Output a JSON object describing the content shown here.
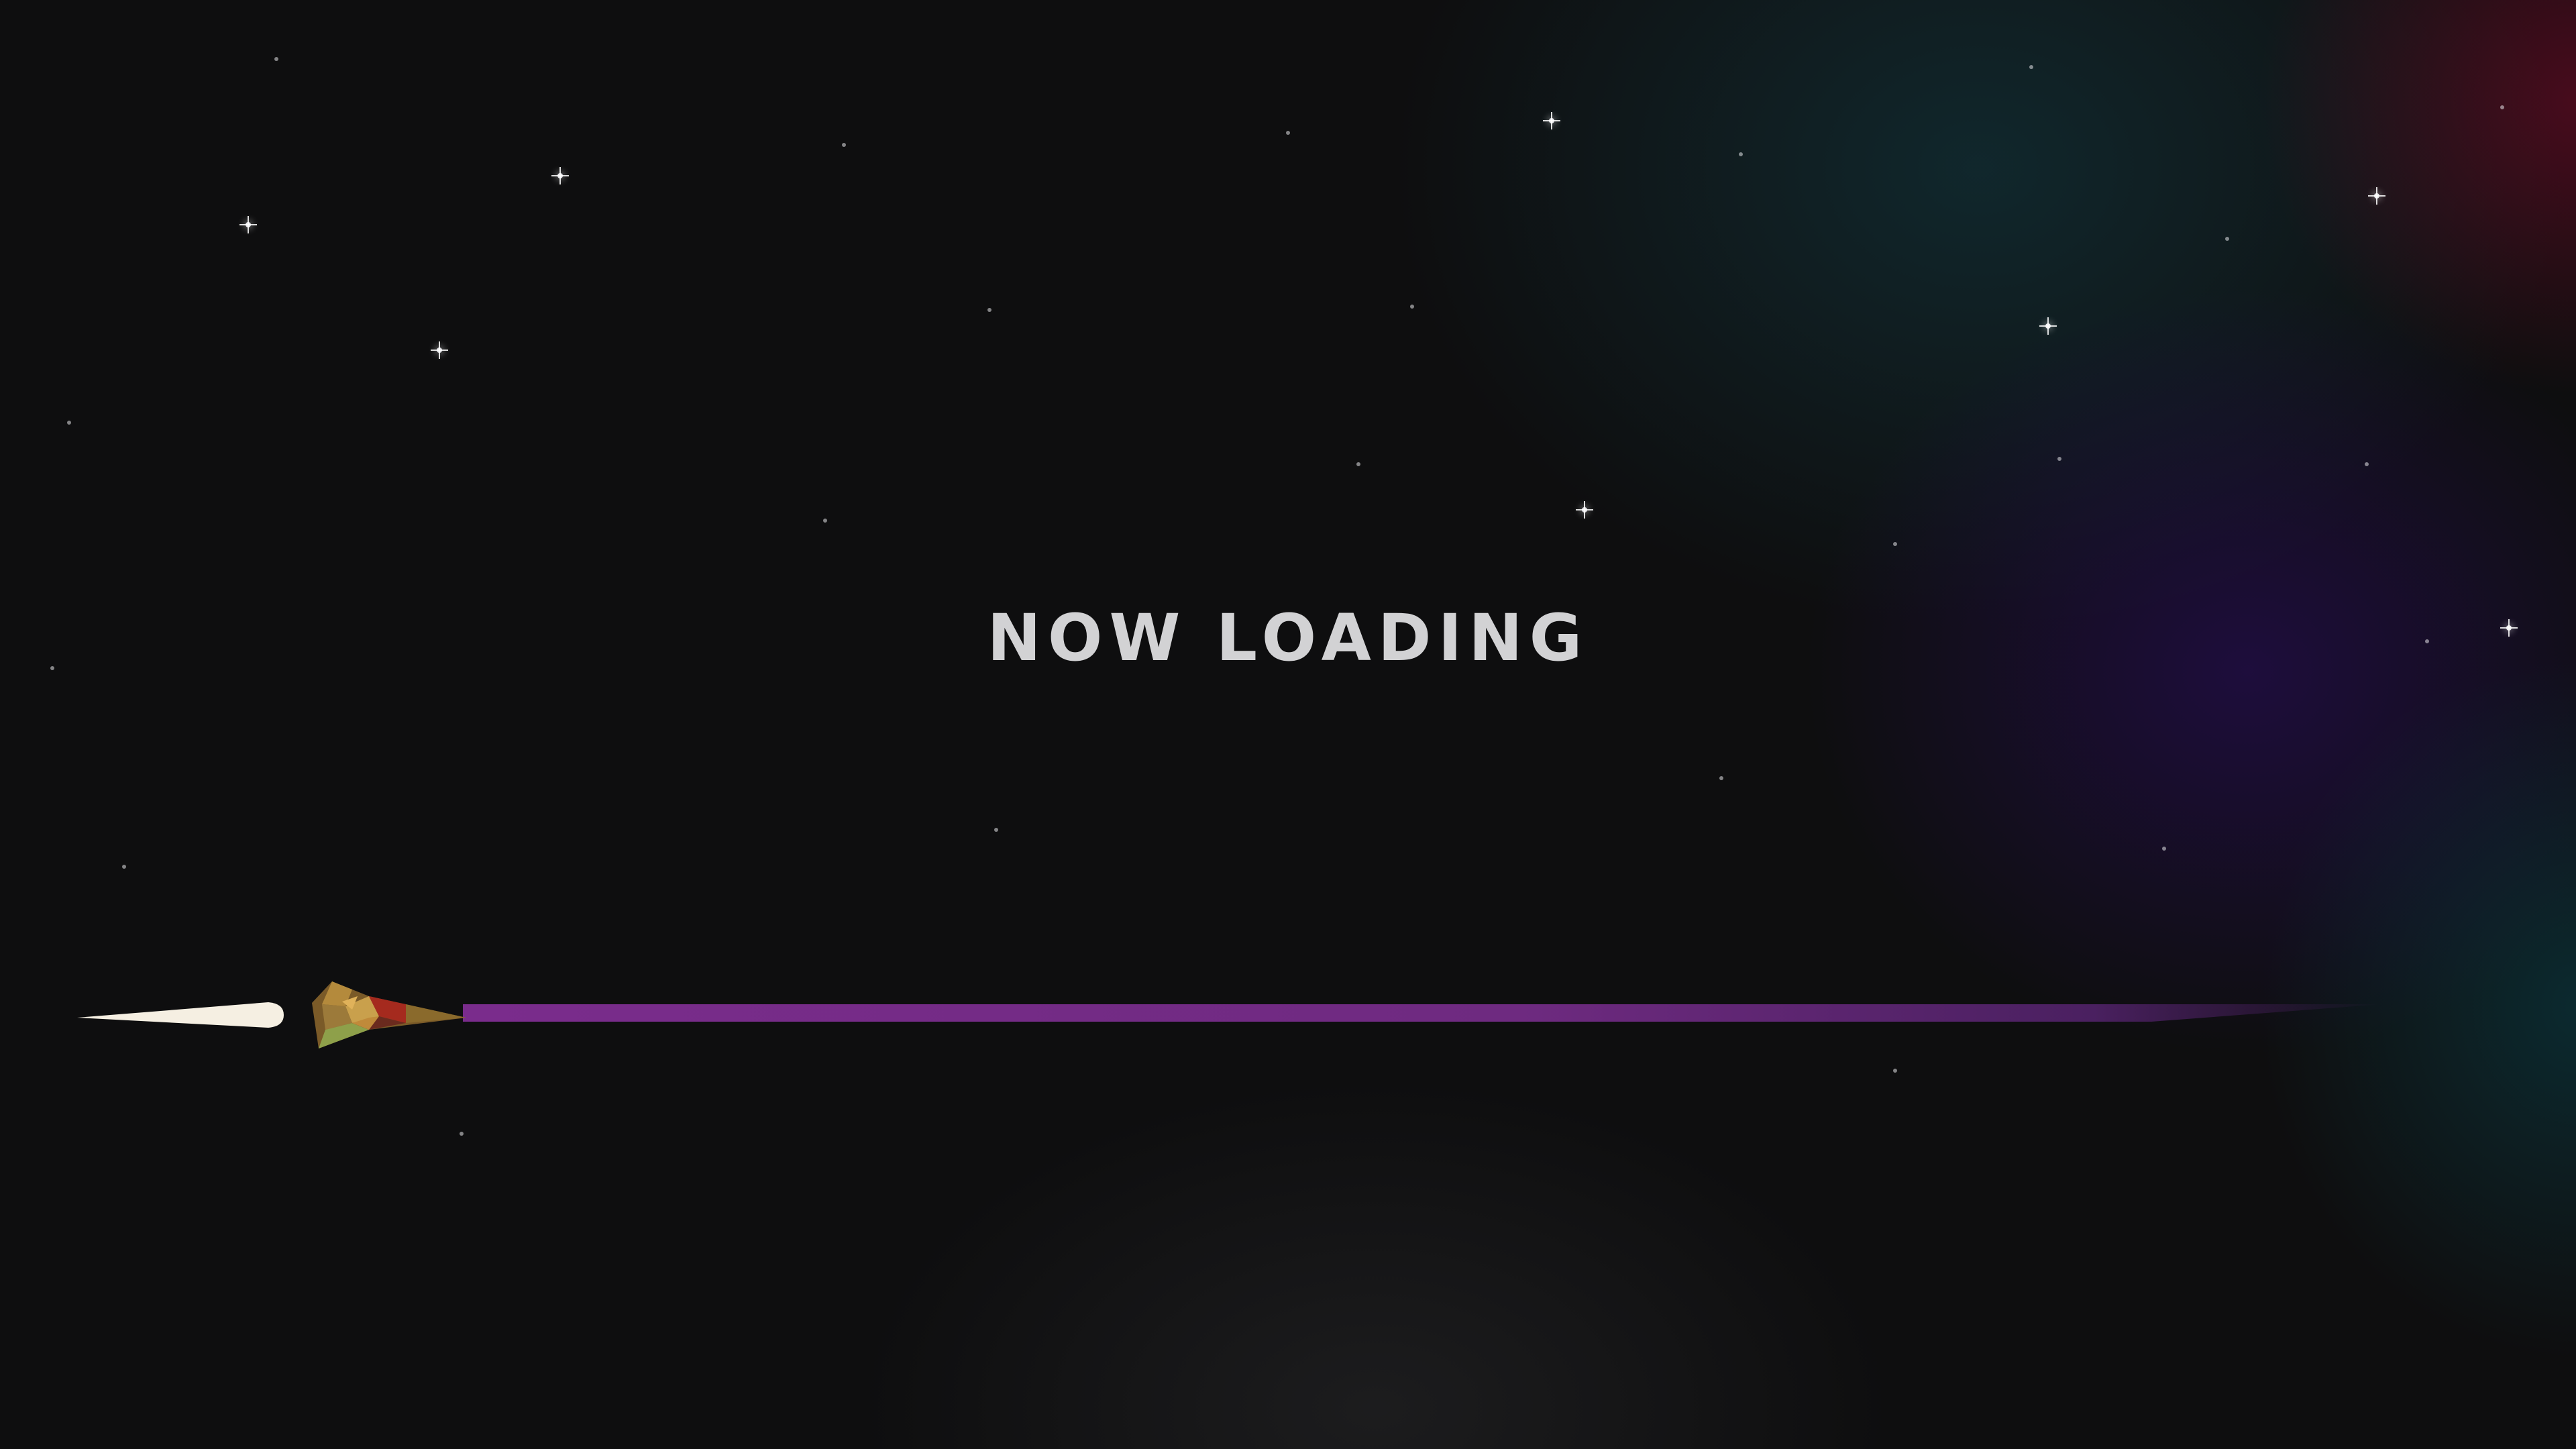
{
  "loading_screen": {
    "title": "NOW LOADING",
    "progress_fraction": 0.0
  },
  "colors": {
    "background": "#0e0e0f",
    "title_text": "#d2d2d4",
    "progress_bar": "#7a2c8c",
    "trail": "#f5efe2",
    "ship_primary": "#b48a3c",
    "ship_accent_red": "#a52a1e",
    "ship_accent_green": "#8ea04a"
  },
  "icons": {
    "ship": "spaceship-icon",
    "trail": "exhaust-trail-icon",
    "stars": "star-sparkle-icon"
  }
}
